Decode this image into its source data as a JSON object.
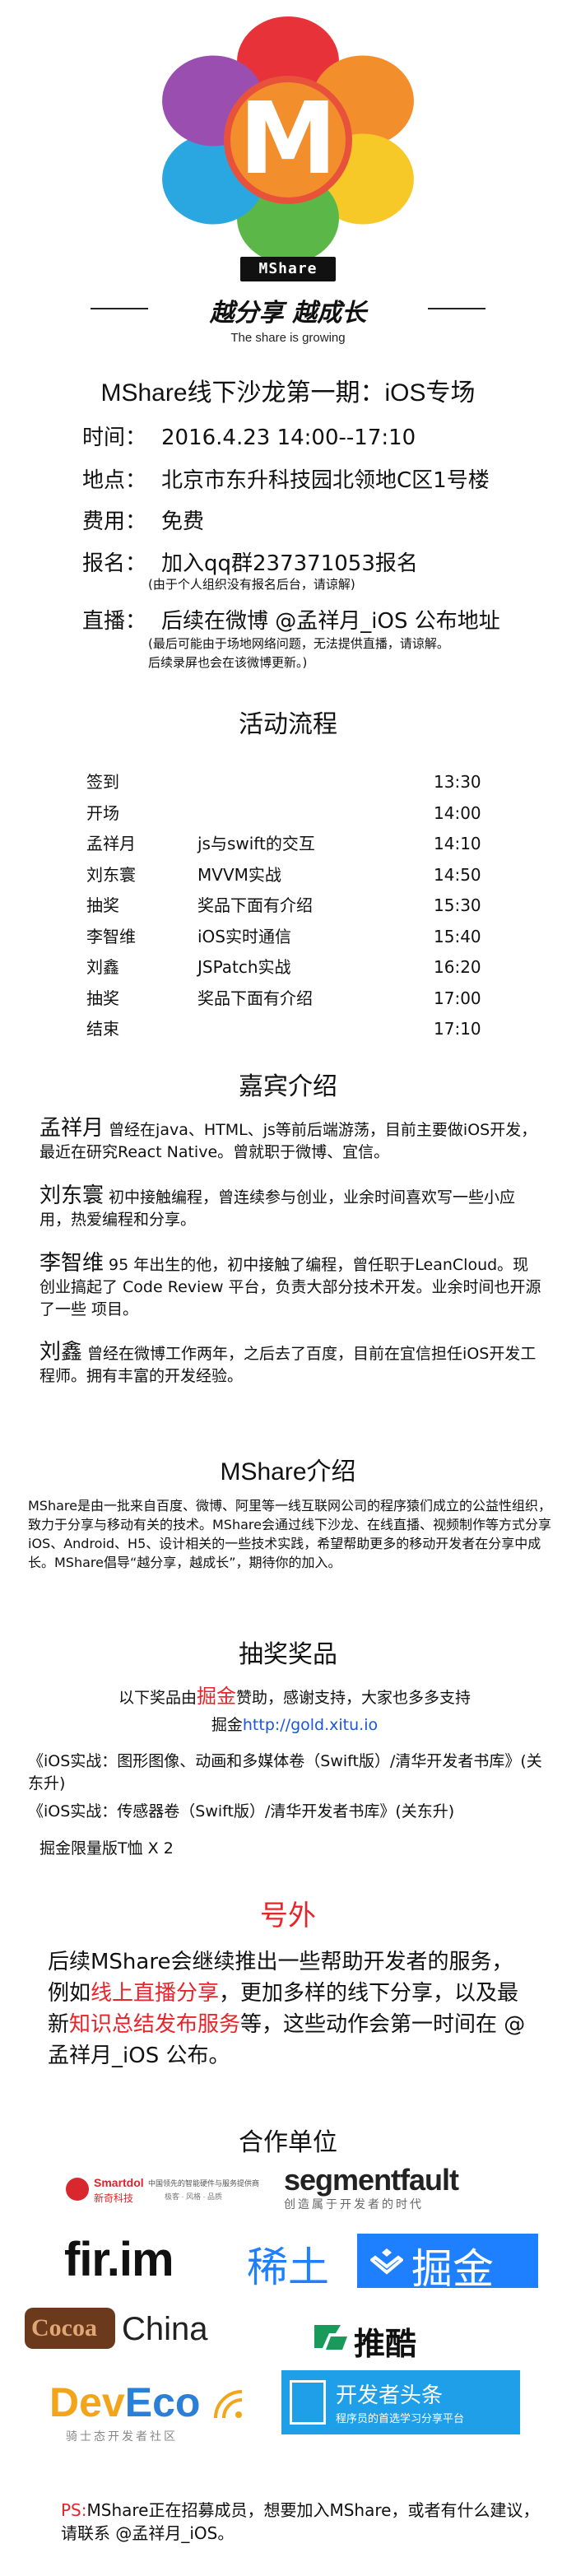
{
  "logo": {
    "letter": "M",
    "tag": "MShare",
    "slogan": "越分享 越成长",
    "slogan_en": "The share is growing",
    "colors": [
      "#e8323a",
      "#f28e2b",
      "#f7c928",
      "#5bb848",
      "#2aa7e0",
      "#9a4fb0"
    ]
  },
  "title": "MShare线下沙龙第一期：iOS专场",
  "info": {
    "time_key": "时间：",
    "time_val": "2016.4.23 14:00--17:10",
    "place_key": "地点：",
    "place_val": "北京市东升科技园北领地C区1号楼",
    "fee_key": "费用：",
    "fee_val": "免费",
    "signup_key": "报名：",
    "signup_val": "加入qq群237371053报名",
    "signup_note": "(由于个人组织没有报名后台，请谅解)",
    "live_key": "直播：",
    "live_val": "后续在微博 @孟祥月_iOS 公布地址",
    "live_note_1": "(最后可能由于场地网络问题，无法提供直播，请谅解。",
    "live_note_2": "后续录屏也会在该微博更新。)"
  },
  "schedule": {
    "heading": "活动流程",
    "rows": [
      {
        "who": "签到",
        "topic": "",
        "time": "13:30"
      },
      {
        "who": "开场",
        "topic": "",
        "time": "14:00"
      },
      {
        "who": "孟祥月",
        "topic": "js与swift的交互",
        "time": "14:10"
      },
      {
        "who": "刘东寰",
        "topic": "MVVM实战",
        "time": "14:50"
      },
      {
        "who": "抽奖",
        "topic": "奖品下面有介绍",
        "time": "15:30"
      },
      {
        "who": "李智维",
        "topic": "iOS实时通信",
        "time": "15:40"
      },
      {
        "who": "刘鑫",
        "topic": "JSPatch实战",
        "time": "16:20"
      },
      {
        "who": "抽奖",
        "topic": "奖品下面有介绍",
        "time": "17:00"
      },
      {
        "who": "结束",
        "topic": "",
        "time": "17:10"
      }
    ]
  },
  "guests": {
    "heading": "嘉宾介绍",
    "items": [
      {
        "name": "孟祥月",
        "bio": " 曾经在java、HTML、js等前后端游荡，目前主要做iOS开发，最近在研究React Native。曾就职于微博、宜信。"
      },
      {
        "name": "刘东寰",
        "bio": " 初中接触编程，曾连续参与创业，业余时间喜欢写一些小应用，热爱编程和分享。"
      },
      {
        "name": "李智维",
        "bio": " 95 年出生的他，初中接触了编程，曾任职于LeanCloud。现创业搞起了 Code Review 平台，负责大部分技术开发。业余时间也开源了一些 项目。"
      },
      {
        "name": "刘鑫",
        "bio": " 曾经在微博工作两年，之后去了百度，目前在宜信担任iOS开发工程师。拥有丰富的开发经验。"
      }
    ]
  },
  "about": {
    "heading": "MShare介绍",
    "text": "MShare是由一批来自百度、微博、阿里等一线互联网公司的程序猿们成立的公益性组织，致力于分享与移动有关的技术。MShare会通过线下沙龙、在线直播、视频制作等方式分享iOS、Android、H5、设计相关的一些技术实践，希望帮助更多的移动开发者在分享中成长。MShare倡导“越分享，越成长”，期待你的加入。"
  },
  "prizes": {
    "heading": "抽奖奖品",
    "sponsor_1": "以下奖品由",
    "sponsor_name": "掘金",
    "sponsor_2": "赞助，感谢支持，大家也多多支持",
    "sponsor_3": "掘金",
    "sponsor_url": "http://gold.xitu.io",
    "book_1": "《iOS实战：图形图像、动画和多媒体卷（Swift版）/清华开发者书库》(关东升)",
    "book_2": "《iOS实战：传感器卷（Swift版）/清华开发者书库》(关东升)",
    "book_3": "掘金限量版T恤 X 2"
  },
  "extra": {
    "heading": "号外",
    "t1": "后续MShare会继续推出一些帮助开发者的服务，例如",
    "h1": "线上直播分享",
    "t2": "，更加多样的线下分享，以及最新",
    "h2": "知识总结发布服务",
    "t3": "等，这些动作会第一时间在 @孟祥月_iOS 公布。"
  },
  "partners": {
    "heading": "合作单位",
    "smartdol_name": "Smartdol",
    "smartdol_cn": "新奇科技",
    "smartdol_tag1": "中国领先的智能硬件与服务提供商",
    "smartdol_tag2": "极客 · 风格 · 品质",
    "segfault_name": "segmentfault",
    "segfault_tag": "创造属于开发者的时代",
    "firim_name": "fir.im",
    "xitu_name": "稀土",
    "juejin_name": "掘金",
    "cocoa_name": "Cocoa",
    "china_name": "China",
    "tuicool_name": "推酷",
    "deveco_name": "DevEco",
    "deveco_tag": "骑士态开发者社区",
    "toutiao_name": "开发者头条",
    "toutiao_tag": "程序员的首选学习分享平台"
  },
  "ps": {
    "label": "PS:",
    "text": "MShare正在招募成员，想要加入MShare，或者有什么建议，请联系 @孟祥月_iOS。"
  }
}
